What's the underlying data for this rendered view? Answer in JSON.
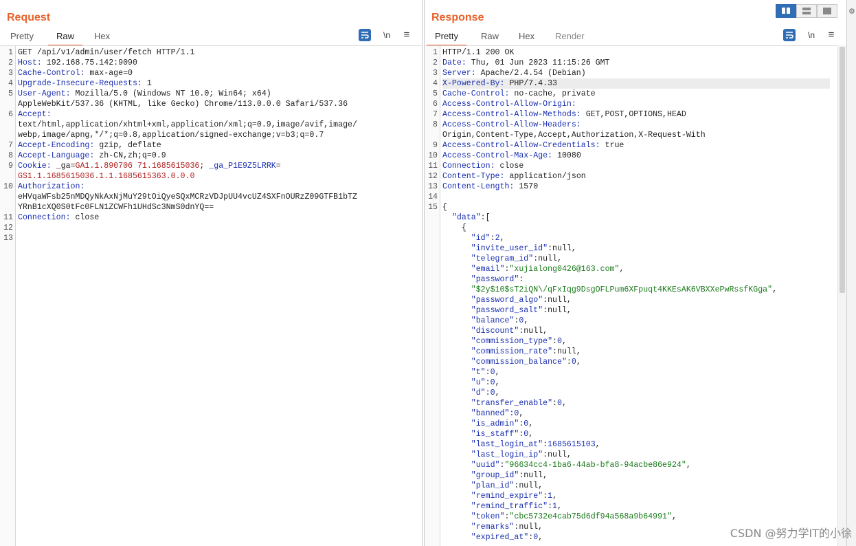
{
  "request": {
    "title": "Request",
    "tabs": [
      {
        "label": "Pretty"
      },
      {
        "label": "Raw"
      },
      {
        "label": "Hex"
      }
    ],
    "tools": {
      "wrap_icon": "wrap-icon",
      "newline_label": "\\n",
      "menu_icon": "≡"
    },
    "lines": [
      {
        "n": "1",
        "parts": [
          {
            "t": "p",
            "v": "GET /api/v1/admin/user/fetch HTTP/1.1"
          }
        ]
      },
      {
        "n": "2",
        "parts": [
          {
            "t": "k",
            "v": "Host:"
          },
          {
            "t": "p",
            "v": " 192.168.75.142:9090"
          }
        ]
      },
      {
        "n": "3",
        "parts": [
          {
            "t": "k",
            "v": "Cache-Control:"
          },
          {
            "t": "p",
            "v": " max-age=0"
          }
        ]
      },
      {
        "n": "4",
        "parts": [
          {
            "t": "k",
            "v": "Upgrade-Insecure-Requests:"
          },
          {
            "t": "p",
            "v": " 1"
          }
        ]
      },
      {
        "n": "5",
        "parts": [
          {
            "t": "k",
            "v": "User-Agent:"
          },
          {
            "t": "p",
            "v": " Mozilla/5.0 (Windows NT 10.0; Win64; x64)"
          }
        ]
      },
      {
        "n": "",
        "parts": [
          {
            "t": "p",
            "v": "AppleWebKit/537.36 (KHTML, like Gecko) Chrome/113.0.0.0 Safari/537.36"
          }
        ]
      },
      {
        "n": "6",
        "parts": [
          {
            "t": "k",
            "v": "Accept:"
          }
        ]
      },
      {
        "n": "",
        "parts": [
          {
            "t": "p",
            "v": "text/html,application/xhtml+xml,application/xml;q=0.9,image/avif,image/"
          }
        ]
      },
      {
        "n": "",
        "parts": [
          {
            "t": "p",
            "v": "webp,image/apng,*/*;q=0.8,application/signed-exchange;v=b3;q=0.7"
          }
        ]
      },
      {
        "n": "7",
        "parts": [
          {
            "t": "k",
            "v": "Accept-Encoding:"
          },
          {
            "t": "p",
            "v": " gzip, deflate"
          }
        ]
      },
      {
        "n": "8",
        "parts": [
          {
            "t": "k",
            "v": "Accept-Language:"
          },
          {
            "t": "p",
            "v": " zh-CN,zh;q=0.9"
          }
        ]
      },
      {
        "n": "9",
        "parts": [
          {
            "t": "k",
            "v": "Cookie:"
          },
          {
            "t": "p",
            "v": " _ga="
          },
          {
            "t": "c",
            "v": "GA1.1.890706 71.1685615036"
          },
          {
            "t": "p",
            "v": "; "
          },
          {
            "t": "k",
            "v": "_ga_P1E9Z5LRRK"
          },
          {
            "t": "p",
            "v": "="
          }
        ]
      },
      {
        "n": "",
        "parts": [
          {
            "t": "c",
            "v": "GS1.1.1685615036.1.1.1685615363.0.0.0"
          }
        ]
      },
      {
        "n": "10",
        "parts": [
          {
            "t": "k",
            "v": "Authorization:"
          }
        ]
      },
      {
        "n": "",
        "parts": [
          {
            "t": "p",
            "v": "eHVqaWFsb25nMDQyNkAxNjMuY29tOiQyeSQxMCRzVDJpUU4vcUZ4SXFnOURzZ09GTFB1bTZ"
          }
        ]
      },
      {
        "n": "",
        "parts": [
          {
            "t": "p",
            "v": "YRnB1cXQ0S0tFc0FLN1ZCWFh1UHdSc3NmS0dnYQ=="
          }
        ]
      },
      {
        "n": "11",
        "parts": [
          {
            "t": "k",
            "v": "Connection:"
          },
          {
            "t": "p",
            "v": " close"
          }
        ]
      },
      {
        "n": "12",
        "parts": []
      },
      {
        "n": "13",
        "parts": []
      }
    ]
  },
  "response": {
    "title": "Response",
    "tabs": [
      {
        "label": "Pretty"
      },
      {
        "label": "Raw"
      },
      {
        "label": "Hex"
      },
      {
        "label": "Render"
      }
    ],
    "tools": {
      "wrap_icon": "wrap-icon",
      "newline_label": "\\n",
      "menu_icon": "≡"
    },
    "lines": [
      {
        "n": "1",
        "parts": [
          {
            "t": "p",
            "v": "HTTP/1.1 200 OK"
          }
        ]
      },
      {
        "n": "2",
        "parts": [
          {
            "t": "k",
            "v": "Date:"
          },
          {
            "t": "p",
            "v": " Thu, 01 Jun 2023 11:15:26 GMT"
          }
        ]
      },
      {
        "n": "3",
        "parts": [
          {
            "t": "k",
            "v": "Server:"
          },
          {
            "t": "p",
            "v": " Apache/2.4.54 (Debian)"
          }
        ]
      },
      {
        "n": "4",
        "hl": true,
        "parts": [
          {
            "t": "k",
            "v": "X-Powered-By:"
          },
          {
            "t": "p",
            "v": " PHP/7.4.33"
          }
        ]
      },
      {
        "n": "5",
        "parts": [
          {
            "t": "k",
            "v": "Cache-Control:"
          },
          {
            "t": "p",
            "v": " no-cache, private"
          }
        ]
      },
      {
        "n": "6",
        "parts": [
          {
            "t": "k",
            "v": "Access-Control-Allow-Origin:"
          }
        ]
      },
      {
        "n": "7",
        "parts": [
          {
            "t": "k",
            "v": "Access-Control-Allow-Methods:"
          },
          {
            "t": "p",
            "v": " GET,POST,OPTIONS,HEAD"
          }
        ]
      },
      {
        "n": "8",
        "parts": [
          {
            "t": "k",
            "v": "Access-Control-Allow-Headers:"
          }
        ]
      },
      {
        "n": "",
        "parts": [
          {
            "t": "p",
            "v": "Origin,Content-Type,Accept,Authorization,X-Request-With"
          }
        ]
      },
      {
        "n": "9",
        "parts": [
          {
            "t": "k",
            "v": "Access-Control-Allow-Credentials:"
          },
          {
            "t": "p",
            "v": " true"
          }
        ]
      },
      {
        "n": "10",
        "parts": [
          {
            "t": "k",
            "v": "Access-Control-Max-Age:"
          },
          {
            "t": "p",
            "v": " 10080"
          }
        ]
      },
      {
        "n": "11",
        "parts": [
          {
            "t": "k",
            "v": "Connection:"
          },
          {
            "t": "p",
            "v": " close"
          }
        ]
      },
      {
        "n": "12",
        "parts": [
          {
            "t": "k",
            "v": "Content-Type:"
          },
          {
            "t": "p",
            "v": " application/json"
          }
        ]
      },
      {
        "n": "13",
        "parts": [
          {
            "t": "k",
            "v": "Content-Length:"
          },
          {
            "t": "p",
            "v": " 1570"
          }
        ]
      },
      {
        "n": "14",
        "parts": []
      },
      {
        "n": "15",
        "parts": [
          {
            "t": "p",
            "v": "{"
          }
        ]
      },
      {
        "n": "",
        "parts": [
          {
            "t": "p",
            "v": "  "
          },
          {
            "t": "k",
            "v": "\"data\""
          },
          {
            "t": "p",
            "v": ":["
          }
        ]
      },
      {
        "n": "",
        "parts": [
          {
            "t": "p",
            "v": "    {"
          }
        ]
      },
      {
        "n": "",
        "parts": [
          {
            "t": "p",
            "v": "      "
          },
          {
            "t": "k",
            "v": "\"id\""
          },
          {
            "t": "p",
            "v": ":"
          },
          {
            "t": "n",
            "v": "2"
          },
          {
            "t": "p",
            "v": ","
          }
        ]
      },
      {
        "n": "",
        "parts": [
          {
            "t": "p",
            "v": "      "
          },
          {
            "t": "k",
            "v": "\"invite_user_id\""
          },
          {
            "t": "p",
            "v": ":null,"
          }
        ]
      },
      {
        "n": "",
        "parts": [
          {
            "t": "p",
            "v": "      "
          },
          {
            "t": "k",
            "v": "\"telegram_id\""
          },
          {
            "t": "p",
            "v": ":null,"
          }
        ]
      },
      {
        "n": "",
        "parts": [
          {
            "t": "p",
            "v": "      "
          },
          {
            "t": "k",
            "v": "\"email\""
          },
          {
            "t": "p",
            "v": ":"
          },
          {
            "t": "s",
            "v": "\"xujialong0426@163.com\""
          },
          {
            "t": "p",
            "v": ","
          }
        ]
      },
      {
        "n": "",
        "parts": [
          {
            "t": "p",
            "v": "      "
          },
          {
            "t": "k",
            "v": "\"password\""
          },
          {
            "t": "p",
            "v": ":"
          }
        ]
      },
      {
        "n": "",
        "parts": [
          {
            "t": "p",
            "v": "      "
          },
          {
            "t": "s",
            "v": "\"$2y$10$sT2iQN\\/qFxIqg9DsgOFLPum6XFpuqt4KKEsAK6VBXXePwRssfKGga\""
          },
          {
            "t": "p",
            "v": ","
          }
        ]
      },
      {
        "n": "",
        "parts": [
          {
            "t": "p",
            "v": "      "
          },
          {
            "t": "k",
            "v": "\"password_algo\""
          },
          {
            "t": "p",
            "v": ":null,"
          }
        ]
      },
      {
        "n": "",
        "parts": [
          {
            "t": "p",
            "v": "      "
          },
          {
            "t": "k",
            "v": "\"password_salt\""
          },
          {
            "t": "p",
            "v": ":null,"
          }
        ]
      },
      {
        "n": "",
        "parts": [
          {
            "t": "p",
            "v": "      "
          },
          {
            "t": "k",
            "v": "\"balance\""
          },
          {
            "t": "p",
            "v": ":"
          },
          {
            "t": "n",
            "v": "0"
          },
          {
            "t": "p",
            "v": ","
          }
        ]
      },
      {
        "n": "",
        "parts": [
          {
            "t": "p",
            "v": "      "
          },
          {
            "t": "k",
            "v": "\"discount\""
          },
          {
            "t": "p",
            "v": ":null,"
          }
        ]
      },
      {
        "n": "",
        "parts": [
          {
            "t": "p",
            "v": "      "
          },
          {
            "t": "k",
            "v": "\"commission_type\""
          },
          {
            "t": "p",
            "v": ":"
          },
          {
            "t": "n",
            "v": "0"
          },
          {
            "t": "p",
            "v": ","
          }
        ]
      },
      {
        "n": "",
        "parts": [
          {
            "t": "p",
            "v": "      "
          },
          {
            "t": "k",
            "v": "\"commission_rate\""
          },
          {
            "t": "p",
            "v": ":null,"
          }
        ]
      },
      {
        "n": "",
        "parts": [
          {
            "t": "p",
            "v": "      "
          },
          {
            "t": "k",
            "v": "\"commission_balance\""
          },
          {
            "t": "p",
            "v": ":"
          },
          {
            "t": "n",
            "v": "0"
          },
          {
            "t": "p",
            "v": ","
          }
        ]
      },
      {
        "n": "",
        "parts": [
          {
            "t": "p",
            "v": "      "
          },
          {
            "t": "k",
            "v": "\"t\""
          },
          {
            "t": "p",
            "v": ":"
          },
          {
            "t": "n",
            "v": "0"
          },
          {
            "t": "p",
            "v": ","
          }
        ]
      },
      {
        "n": "",
        "parts": [
          {
            "t": "p",
            "v": "      "
          },
          {
            "t": "k",
            "v": "\"u\""
          },
          {
            "t": "p",
            "v": ":"
          },
          {
            "t": "n",
            "v": "0"
          },
          {
            "t": "p",
            "v": ","
          }
        ]
      },
      {
        "n": "",
        "parts": [
          {
            "t": "p",
            "v": "      "
          },
          {
            "t": "k",
            "v": "\"d\""
          },
          {
            "t": "p",
            "v": ":"
          },
          {
            "t": "n",
            "v": "0"
          },
          {
            "t": "p",
            "v": ","
          }
        ]
      },
      {
        "n": "",
        "parts": [
          {
            "t": "p",
            "v": "      "
          },
          {
            "t": "k",
            "v": "\"transfer_enable\""
          },
          {
            "t": "p",
            "v": ":"
          },
          {
            "t": "n",
            "v": "0"
          },
          {
            "t": "p",
            "v": ","
          }
        ]
      },
      {
        "n": "",
        "parts": [
          {
            "t": "p",
            "v": "      "
          },
          {
            "t": "k",
            "v": "\"banned\""
          },
          {
            "t": "p",
            "v": ":"
          },
          {
            "t": "n",
            "v": "0"
          },
          {
            "t": "p",
            "v": ","
          }
        ]
      },
      {
        "n": "",
        "parts": [
          {
            "t": "p",
            "v": "      "
          },
          {
            "t": "k",
            "v": "\"is_admin\""
          },
          {
            "t": "p",
            "v": ":"
          },
          {
            "t": "n",
            "v": "0"
          },
          {
            "t": "p",
            "v": ","
          }
        ]
      },
      {
        "n": "",
        "parts": [
          {
            "t": "p",
            "v": "      "
          },
          {
            "t": "k",
            "v": "\"is_staff\""
          },
          {
            "t": "p",
            "v": ":"
          },
          {
            "t": "n",
            "v": "0"
          },
          {
            "t": "p",
            "v": ","
          }
        ]
      },
      {
        "n": "",
        "parts": [
          {
            "t": "p",
            "v": "      "
          },
          {
            "t": "k",
            "v": "\"last_login_at\""
          },
          {
            "t": "p",
            "v": ":"
          },
          {
            "t": "n",
            "v": "1685615103"
          },
          {
            "t": "p",
            "v": ","
          }
        ]
      },
      {
        "n": "",
        "parts": [
          {
            "t": "p",
            "v": "      "
          },
          {
            "t": "k",
            "v": "\"last_login_ip\""
          },
          {
            "t": "p",
            "v": ":null,"
          }
        ]
      },
      {
        "n": "",
        "parts": [
          {
            "t": "p",
            "v": "      "
          },
          {
            "t": "k",
            "v": "\"uuid\""
          },
          {
            "t": "p",
            "v": ":"
          },
          {
            "t": "s",
            "v": "\"96634cc4-1ba6-44ab-bfa8-94acbe86e924\""
          },
          {
            "t": "p",
            "v": ","
          }
        ]
      },
      {
        "n": "",
        "parts": [
          {
            "t": "p",
            "v": "      "
          },
          {
            "t": "k",
            "v": "\"group_id\""
          },
          {
            "t": "p",
            "v": ":null,"
          }
        ]
      },
      {
        "n": "",
        "parts": [
          {
            "t": "p",
            "v": "      "
          },
          {
            "t": "k",
            "v": "\"plan_id\""
          },
          {
            "t": "p",
            "v": ":null,"
          }
        ]
      },
      {
        "n": "",
        "parts": [
          {
            "t": "p",
            "v": "      "
          },
          {
            "t": "k",
            "v": "\"remind_expire\""
          },
          {
            "t": "p",
            "v": ":"
          },
          {
            "t": "n",
            "v": "1"
          },
          {
            "t": "p",
            "v": ","
          }
        ]
      },
      {
        "n": "",
        "parts": [
          {
            "t": "p",
            "v": "      "
          },
          {
            "t": "k",
            "v": "\"remind_traffic\""
          },
          {
            "t": "p",
            "v": ":"
          },
          {
            "t": "n",
            "v": "1"
          },
          {
            "t": "p",
            "v": ","
          }
        ]
      },
      {
        "n": "",
        "parts": [
          {
            "t": "p",
            "v": "      "
          },
          {
            "t": "k",
            "v": "\"token\""
          },
          {
            "t": "p",
            "v": ":"
          },
          {
            "t": "s",
            "v": "\"cbc5732e4cab75d6df94a568a9b64991\""
          },
          {
            "t": "p",
            "v": ","
          }
        ]
      },
      {
        "n": "",
        "parts": [
          {
            "t": "p",
            "v": "      "
          },
          {
            "t": "k",
            "v": "\"remarks\""
          },
          {
            "t": "p",
            "v": ":null,"
          }
        ]
      },
      {
        "n": "",
        "parts": [
          {
            "t": "p",
            "v": "      "
          },
          {
            "t": "k",
            "v": "\"expired_at\""
          },
          {
            "t": "p",
            "v": ":"
          },
          {
            "t": "n",
            "v": "0"
          },
          {
            "t": "p",
            "v": ","
          }
        ]
      }
    ]
  },
  "watermark": "CSDN @努力学IT的小徐",
  "colors": {
    "accent": "#e8622c",
    "header_key": "#1a2fb0",
    "string": "#1a7a1a",
    "cookie_value": "#b01c1c",
    "button_blue": "#2f6db5"
  }
}
